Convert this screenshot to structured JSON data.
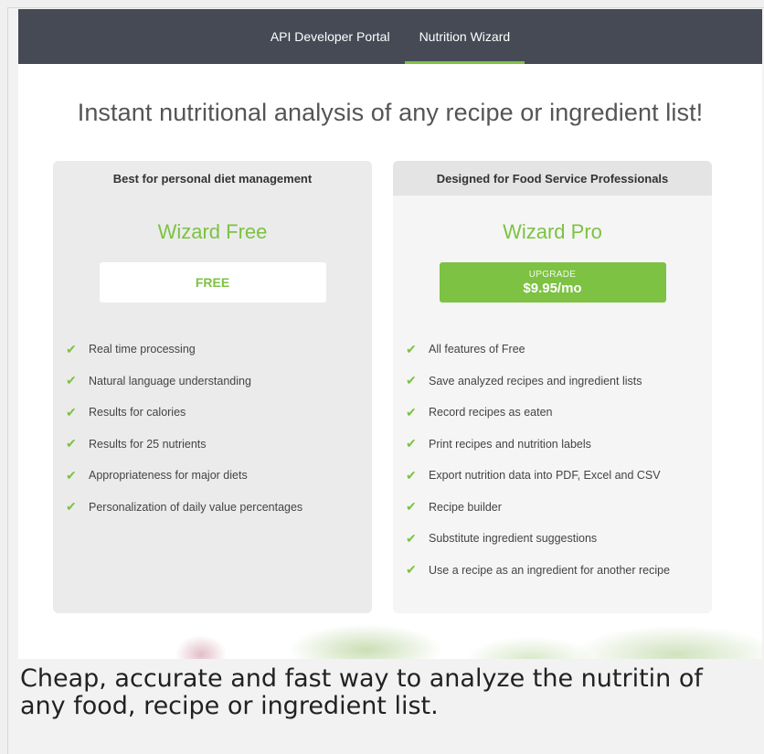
{
  "nav": {
    "items": [
      {
        "label": "API Developer Portal",
        "active": false
      },
      {
        "label": "Nutrition Wizard",
        "active": true
      }
    ]
  },
  "headline": "Instant nutritional analysis of any recipe or ingredient list!",
  "plans": {
    "free": {
      "tag": "Best for personal diet management",
      "name": "Wizard Free",
      "button": "FREE",
      "features": [
        "Real time processing",
        "Natural language understanding",
        "Results for calories",
        "Results for 25 nutrients",
        "Appropriateness for major diets",
        "Personalization of daily value percentages"
      ]
    },
    "pro": {
      "tag": "Designed for Food Service Professionals",
      "name": "Wizard Pro",
      "button_small": "UPGRADE",
      "button_price": "$9.95/mo",
      "features": [
        "All features of Free",
        "Save analyzed recipes and ingredient lists",
        "Record recipes as eaten",
        "Print recipes and nutrition labels",
        "Export nutrition data into PDF, Excel and CSV",
        "Recipe builder",
        "Substitute ingredient suggestions",
        "Use a recipe as an ingredient for another recipe"
      ]
    }
  },
  "caption": "Cheap, accurate and fast way to analyze the nutritin of any food, recipe or ingredient list.",
  "colors": {
    "accent": "#7dc242",
    "nav_bg": "#454a55"
  },
  "icons": {
    "check": "check-icon"
  }
}
